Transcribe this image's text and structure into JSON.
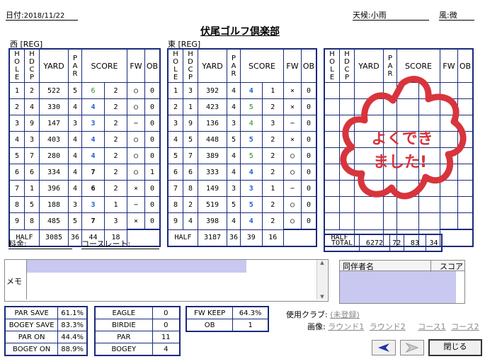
{
  "header": {
    "date_label": "日付:",
    "date": "2018/11/22",
    "weather_label": "天候:",
    "weather": "小雨",
    "wind_label": "風:",
    "wind": "微",
    "club_name": "伏尾ゴルフ倶楽部"
  },
  "course_out": {
    "label": "西 [REG]"
  },
  "course_in": {
    "label": "東 [REG]"
  },
  "columns": {
    "hole": "HOLE",
    "hdcp": "HDCP",
    "yard": "YARD",
    "par": "PAR",
    "score": "SCORE",
    "fw": "FW",
    "ob": "OB"
  },
  "out_rows": [
    {
      "hole": "1",
      "hdcp": "2",
      "yard": "522",
      "par": "5",
      "score": "6",
      "putt": "2",
      "fw": "○",
      "ob": "0"
    },
    {
      "hole": "2",
      "hdcp": "4",
      "yard": "330",
      "par": "4",
      "score": "4",
      "putt": "2",
      "fw": "○",
      "ob": "0"
    },
    {
      "hole": "3",
      "hdcp": "9",
      "yard": "147",
      "par": "3",
      "score": "3",
      "putt": "2",
      "fw": "−",
      "ob": "0"
    },
    {
      "hole": "4",
      "hdcp": "3",
      "yard": "403",
      "par": "4",
      "score": "4",
      "putt": "2",
      "fw": "○",
      "ob": "0"
    },
    {
      "hole": "5",
      "hdcp": "7",
      "yard": "280",
      "par": "4",
      "score": "4",
      "putt": "2",
      "fw": "○",
      "ob": "0"
    },
    {
      "hole": "6",
      "hdcp": "6",
      "yard": "334",
      "par": "4",
      "score": "7",
      "putt": "2",
      "fw": "○",
      "ob": "1"
    },
    {
      "hole": "7",
      "hdcp": "1",
      "yard": "396",
      "par": "4",
      "score": "6",
      "putt": "2",
      "fw": "×",
      "ob": "0"
    },
    {
      "hole": "8",
      "hdcp": "5",
      "yard": "188",
      "par": "3",
      "score": "3",
      "putt": "1",
      "fw": "−",
      "ob": "0"
    },
    {
      "hole": "9",
      "hdcp": "8",
      "yard": "485",
      "par": "5",
      "score": "7",
      "putt": "3",
      "fw": "×",
      "ob": "0"
    }
  ],
  "out_half": {
    "label": "HALF",
    "yard": "3085",
    "par": "36",
    "score": "44",
    "putt": "18"
  },
  "in_rows": [
    {
      "hole": "1",
      "hdcp": "3",
      "yard": "392",
      "par": "4",
      "score": "4",
      "putt": "1",
      "fw": "×",
      "ob": "0"
    },
    {
      "hole": "2",
      "hdcp": "1",
      "yard": "423",
      "par": "4",
      "score": "5",
      "putt": "2",
      "fw": "×",
      "ob": "0"
    },
    {
      "hole": "3",
      "hdcp": "9",
      "yard": "136",
      "par": "3",
      "score": "4",
      "putt": "3",
      "fw": "−",
      "ob": "0"
    },
    {
      "hole": "4",
      "hdcp": "5",
      "yard": "448",
      "par": "5",
      "score": "5",
      "putt": "2",
      "fw": "×",
      "ob": "0"
    },
    {
      "hole": "5",
      "hdcp": "7",
      "yard": "389",
      "par": "4",
      "score": "5",
      "putt": "2",
      "fw": "○",
      "ob": "0"
    },
    {
      "hole": "6",
      "hdcp": "6",
      "yard": "333",
      "par": "4",
      "score": "4",
      "putt": "2",
      "fw": "○",
      "ob": "0"
    },
    {
      "hole": "7",
      "hdcp": "8",
      "yard": "149",
      "par": "3",
      "score": "3",
      "putt": "1",
      "fw": "−",
      "ob": "0"
    },
    {
      "hole": "8",
      "hdcp": "2",
      "yard": "519",
      "par": "5",
      "score": "5",
      "putt": "2",
      "fw": "○",
      "ob": "0"
    },
    {
      "hole": "9",
      "hdcp": "4",
      "yard": "398",
      "par": "4",
      "score": "4",
      "putt": "2",
      "fw": "○",
      "ob": "0"
    }
  ],
  "in_half": {
    "label": "HALF",
    "yard": "3187",
    "par": "36",
    "score": "39",
    "putt": "16"
  },
  "third_half": {
    "label": "HALF"
  },
  "total": {
    "label": "TOTAL",
    "yard": "6272",
    "par": "72",
    "score": "83",
    "putt": "34"
  },
  "stamp": {
    "line1": "よくでき",
    "line2": "ました!",
    "color": "#d8343c"
  },
  "fee_label": "料金:",
  "course_rate_label": "コースレート:",
  "memo_label": "メモ",
  "companions": {
    "name_header": "同伴者名",
    "score_header": "スコア"
  },
  "stats1": [
    {
      "label": "PAR SAVE",
      "value": "61.1%"
    },
    {
      "label": "BOGEY SAVE",
      "value": "83.3%"
    },
    {
      "label": "PAR ON",
      "value": "44.4%"
    },
    {
      "label": "BOGEY ON",
      "value": "88.9%"
    }
  ],
  "stats2": [
    {
      "label": "EAGLE",
      "value": "0"
    },
    {
      "label": "BIRDIE",
      "value": "0"
    },
    {
      "label": "PAR",
      "value": "11"
    },
    {
      "label": "BOGEY",
      "value": "4"
    }
  ],
  "stats3": [
    {
      "label": "FW KEEP",
      "value": "64.3%"
    },
    {
      "label": "OB",
      "value": "1"
    }
  ],
  "clubs_label": "使用クラブ:",
  "clubs_link": "(未登録)",
  "images_label": "画像:",
  "image_links": [
    "ラウンド1",
    "ラウンド2",
    "コース1",
    "コース2"
  ],
  "buttons": {
    "close": "閉じる"
  }
}
